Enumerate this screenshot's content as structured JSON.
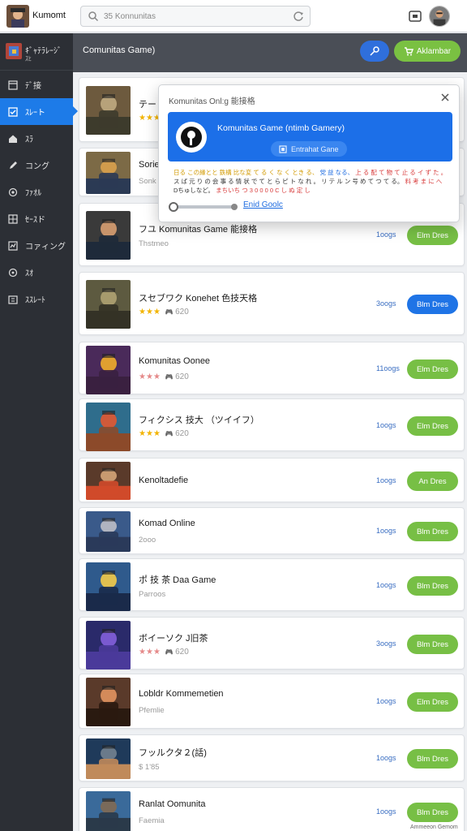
{
  "topbar": {
    "app_title": "Kumomt",
    "search_placeholder": "35 Konnunitas"
  },
  "sidebar": {
    "header_title": "ｷﾞｬﾃﾗﾚｰｼﾞ",
    "header_sub": "ｽﾋ",
    "items": [
      {
        "label": "ﾃﾞ接",
        "icon": "window-icon",
        "active": false
      },
      {
        "label": "ｽﾚｰト",
        "icon": "checkbox-icon",
        "active": true
      },
      {
        "label": "ｽﾗ",
        "icon": "home-icon",
        "active": false
      },
      {
        "label": "コング",
        "icon": "pen-icon",
        "active": false
      },
      {
        "label": "ﾌｧｵﾙ",
        "icon": "target-icon",
        "active": false
      },
      {
        "label": "ｾｰｽド",
        "icon": "grid-icon",
        "active": false
      },
      {
        "label": "コァィング",
        "icon": "chart-icon",
        "active": false
      },
      {
        "label": "ｽｵ",
        "icon": "circle-icon",
        "active": false
      },
      {
        "label": "ｽｽﾚｰﾄ",
        "icon": "tray-icon",
        "active": false
      }
    ]
  },
  "band": {
    "title": "Comunitas Game)",
    "action_label": "Aklambar"
  },
  "popup": {
    "title": "Komunitas Onl:g 能接格",
    "name": "Komunitas Game (ntimb Gamery)",
    "tag": "Entrahat Gane",
    "note_line1_yellow": "日る この縁とと 鉄構 比な変 て る く な く とき る、",
    "note_line1_blue": "党 益 なる、",
    "note_line1_red": "上 る 配 て 物 て 止 る イ ず た 。",
    "note_line2_dark": "ス ば 元 り の 会 事 る 情 状 で て と ら ピ ト な れ 。 リ テ ル ン 号 め て つ て る。",
    "note_line2_red": "料 考 ま に へ",
    "note_line3_dark": "Dちゅしなど。",
    "note_line3_red": "まちいち つ 3 0 0 0 0 C し ぬ 定 し",
    "link": "Enid Goolc"
  },
  "games": [
    {
      "title": "テー",
      "sub": "Mdm",
      "stars": 3,
      "star_color": "gold",
      "meta": "",
      "price": "",
      "button": "",
      "button_color": ""
    },
    {
      "title": "Sorie",
      "sub": "Sonk",
      "stars": 0,
      "star_color": "",
      "meta": "",
      "price": "",
      "button": "",
      "button_color": ""
    },
    {
      "title": "フユ Komunitas Game 能接格",
      "sub": "Thstmeo",
      "stars": 0,
      "star_color": "",
      "meta": "",
      "price": "1oogs",
      "button": "Elm Dres",
      "button_color": "green"
    },
    {
      "title": "スセブワク Konehet 色技天格",
      "sub": "",
      "stars": 3,
      "star_color": "gold",
      "meta": "620",
      "price": "3oogs",
      "button": "Blm Dres",
      "button_color": "blue"
    },
    {
      "title": "Komunitas Oonee",
      "sub": "",
      "stars": 3,
      "star_color": "red",
      "meta": "620",
      "price": "11oogs",
      "button": "Elm Dres",
      "button_color": "green"
    },
    {
      "title": "フィクシス 技大 （ツイイフ）",
      "sub": "",
      "stars": 3,
      "star_color": "gold",
      "meta": "620",
      "price": "1oogs",
      "button": "Elm Dres",
      "button_color": "green"
    },
    {
      "title": "Kenoltadefie",
      "sub": "",
      "stars": 0,
      "star_color": "",
      "meta": "",
      "price": "1oogs",
      "button": "An Dres",
      "button_color": "green"
    },
    {
      "title": "Komad Online",
      "sub": "2ooo",
      "stars": 0,
      "star_color": "",
      "meta": "",
      "price": "1oogs",
      "button": "Blm Dres",
      "button_color": "green"
    },
    {
      "title": "ポ 技 茶  Daa Game",
      "sub": "Parroos",
      "stars": 0,
      "star_color": "",
      "meta": "",
      "price": "1oogs",
      "button": "Blm Dres",
      "button_color": "green"
    },
    {
      "title": "ボイーソク J旧茶",
      "sub": "",
      "stars": 3,
      "star_color": "red",
      "meta": "620",
      "price": "3oogs",
      "button": "Blm Dres",
      "button_color": "green"
    },
    {
      "title": "Lobldr Kommemetien",
      "sub": "Pfemlie",
      "stars": 0,
      "star_color": "",
      "meta": "",
      "price": "1oogs",
      "button": "Elm Dres",
      "button_color": "green"
    },
    {
      "title": "フッルクタ２(話)",
      "sub": "$ 1'85",
      "stars": 0,
      "star_color": "",
      "meta": "",
      "price": "1oogs",
      "button": "Blm Dres",
      "button_color": "green"
    },
    {
      "title": "Ranlat Oomunita",
      "sub": "Faemia",
      "stars": 0,
      "star_color": "",
      "meta": "",
      "price": "1oogs",
      "button": "Blm Dres",
      "button_color": "green"
    }
  ],
  "corner_text": "Ammeeon Gemom"
}
